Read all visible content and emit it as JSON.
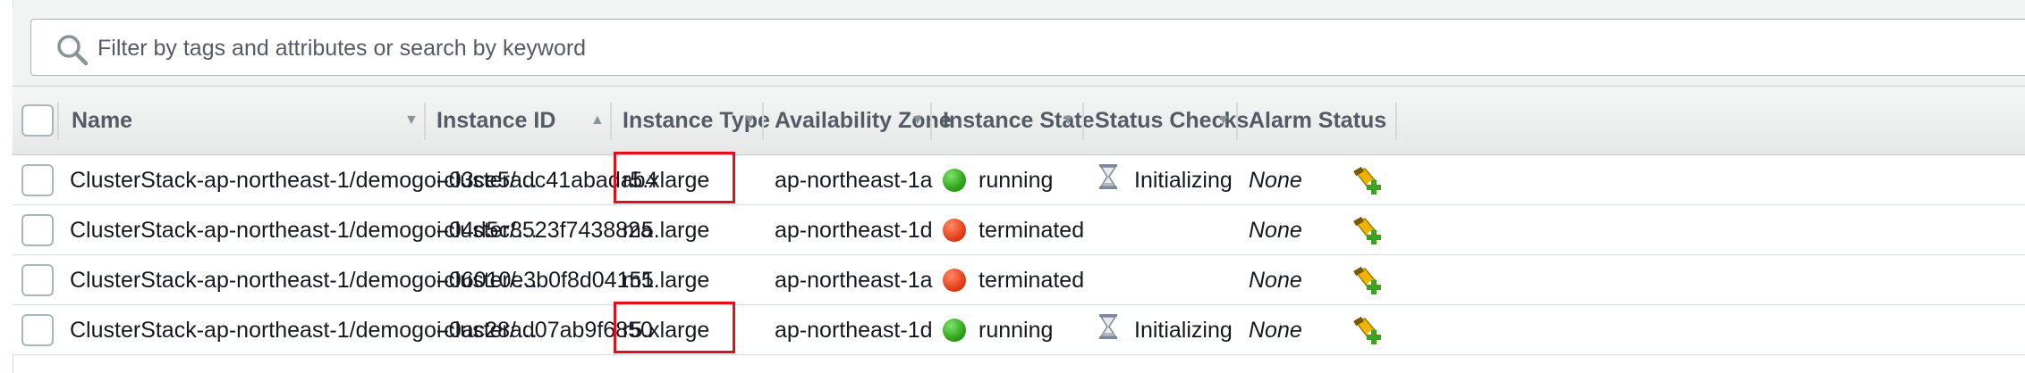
{
  "filter": {
    "placeholder": "Filter by tags and attributes or search by keyword"
  },
  "columns": {
    "name": "Name",
    "instance_id": "Instance ID",
    "instance_type": "Instance Type",
    "availability_zone": "Availability Zone",
    "instance_state": "Instance State",
    "status_checks": "Status Checks",
    "alarm_status": "Alarm Status"
  },
  "rows": [
    {
      "name": "ClusterStack-ap-northeast-1/demogo-cluster/…",
      "instance_id": "i-03ce5adc41abadab4",
      "instance_type": "r5.xlarge",
      "availability_zone": "ap-northeast-1a",
      "instance_state": "running",
      "status_checks": "Initializing",
      "alarm_status": "None"
    },
    {
      "name": "ClusterStack-ap-northeast-1/demogo-cluster/…",
      "instance_id": "i-04d5c8523f743882a",
      "instance_type": "m5.large",
      "availability_zone": "ap-northeast-1d",
      "instance_state": "terminated",
      "status_checks": "",
      "alarm_status": "None"
    },
    {
      "name": "ClusterStack-ap-northeast-1/demogo-cluster/…",
      "instance_id": "i-06010e3b0f8d04151",
      "instance_type": "m5.large",
      "availability_zone": "ap-northeast-1a",
      "instance_state": "terminated",
      "status_checks": "",
      "alarm_status": "None"
    },
    {
      "name": "ClusterStack-ap-northeast-1/demogo-cluster/…",
      "instance_id": "i-0ac28ad07ab9f6850",
      "instance_type": "r5.xlarge",
      "availability_zone": "ap-northeast-1d",
      "instance_state": "running",
      "status_checks": "Initializing",
      "alarm_status": "None"
    }
  ],
  "colors": {
    "running": "#2fa51a",
    "terminated": "#e5401a",
    "highlight": "#e0101a"
  },
  "icons": {
    "search": "search-icon",
    "sort_desc": "caret-down-icon",
    "sort_asc": "caret-up-icon",
    "status_initializing": "hourglass-icon",
    "alarm_action": "create-alarm-icon"
  }
}
